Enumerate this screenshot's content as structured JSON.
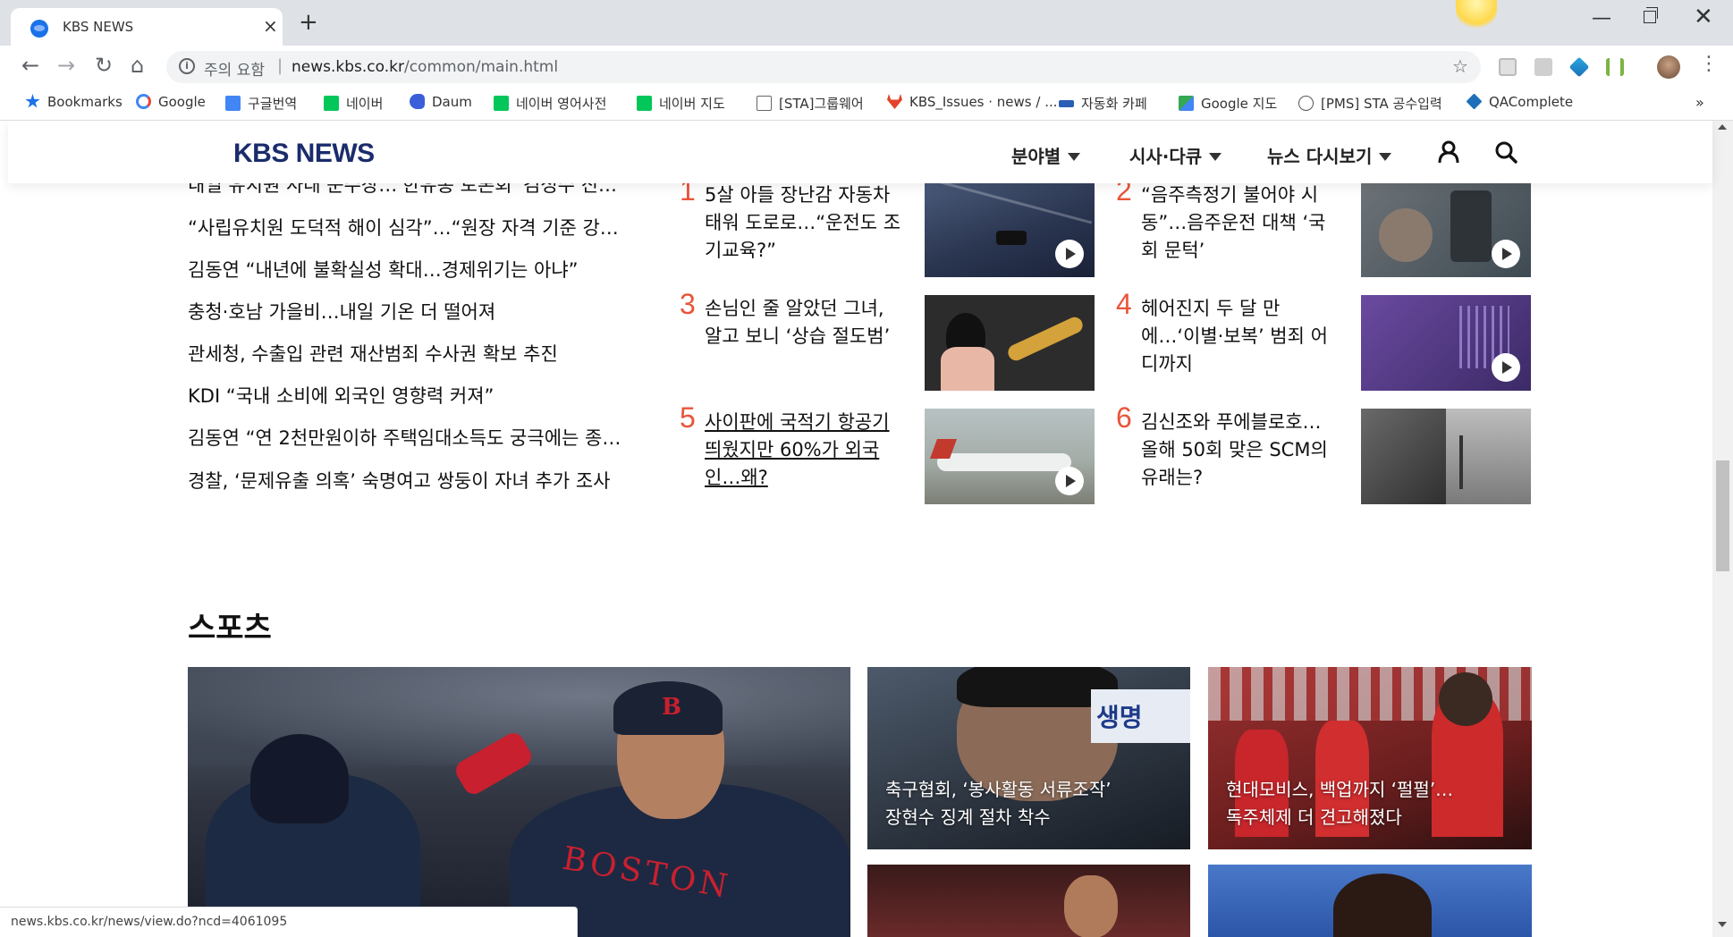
{
  "browser": {
    "tab_title": "KBS NEWS",
    "tab_close": "×",
    "new_tab": "+",
    "window_min": "—",
    "window_close": "✕",
    "security_warning": "주의 요함",
    "url_host": "news.kbs.co.kr",
    "url_path": "/common/main.html",
    "separator": "|",
    "star": "☆",
    "menu": "⋮",
    "back": "←",
    "forward": "→",
    "reload": "↻",
    "home": "⌂"
  },
  "bookmarks": [
    {
      "label": "Bookmarks",
      "icon": "star-icon",
      "color": "#1a73e8"
    },
    {
      "label": "Google",
      "icon": "google-icon",
      "color": "#4285f4"
    },
    {
      "label": "구글번역",
      "icon": "translate-icon",
      "color": "#4285f4"
    },
    {
      "label": "네이버",
      "icon": "naver-icon",
      "color": "#03c75a"
    },
    {
      "label": "Daum",
      "icon": "daum-icon",
      "color": "#3a5fd9"
    },
    {
      "label": "네이버 영어사전",
      "icon": "dict-icon",
      "color": "#03c75a"
    },
    {
      "label": "네이버 지도",
      "icon": "naver-icon",
      "color": "#03c75a"
    },
    {
      "label": "[STA]그룹웨어",
      "icon": "page-icon",
      "color": "#888888"
    },
    {
      "label": "KBS_Issues · news / ...",
      "icon": "gitlab-icon",
      "color": "#e24329"
    },
    {
      "label": "자동화 카페",
      "icon": "cafe-icon",
      "color": "#2b5fb5"
    },
    {
      "label": "Google 지도",
      "icon": "maps-icon",
      "color": "#34a853"
    },
    {
      "label": "[PMS] STA 공수입력",
      "icon": "pms-icon",
      "color": "#555555"
    },
    {
      "label": "QAComplete",
      "icon": "qa-icon",
      "color": "#1c6fb8"
    }
  ],
  "bookmarks_more": "»",
  "site": {
    "logo": "KBS NEWS",
    "nav": [
      "분야별",
      "시사·다큐",
      "뉴스 다시보기"
    ]
  },
  "headlines": [
    "내일 유치원 사태 운수장…'한유총 토론회' 김성수 진…",
    "“사립유치원 도덕적 해이 심각”…“원장 자격 기준 강…",
    "김동연 “내년에 불확실성 확대…경제위기는 아냐”",
    "충청·호남 가을비…내일 기온 더 떨어져",
    "관세청, 수출입 관련 재산범죄 수사권 확보 추진",
    "KDI “국내 소비에 외국인 영향력 커져”",
    "김동연 “연 2천만원이하 주택임대소득도 궁극에는 종…",
    "경찰, ‘문제유출 의혹’ 숙명여고 쌍둥이 자녀 추가 조사"
  ],
  "ranked": [
    {
      "num": "1",
      "text": "5살 아들 장난감 자동차 태워 도로로…“운전도 조기교육?”"
    },
    {
      "num": "2",
      "text": "“음주측정기 불어야 시동”…음주운전 대책 ‘국회 문턱’"
    },
    {
      "num": "3",
      "text": "손님인 줄 알았던 그녀, 알고 보니 ‘상습 절도범’"
    },
    {
      "num": "4",
      "text": "헤어진지 두 달 만에…‘이별·보복’ 범죄 어디까지"
    },
    {
      "num": "5",
      "text": "사이판에 국적기 항공기 띄웠지만 60%가 외국인…왜?"
    },
    {
      "num": "6",
      "text": "김신조와 푸에블로호… 올해 50회 맞은 SCM의 유래는?"
    }
  ],
  "sports": {
    "title": "스포츠",
    "cards": [
      {
        "line1": "축구협회, ‘봉사활동 서류조작’",
        "line2": "장현수 징계 절차 착수"
      },
      {
        "line1": "현대모비스, 백업까지 ‘펄펄’…",
        "line2": "독주체제 더 견고해졌다"
      }
    ]
  },
  "status_url": "news.kbs.co.kr/news/view.do?ncd=4061095"
}
